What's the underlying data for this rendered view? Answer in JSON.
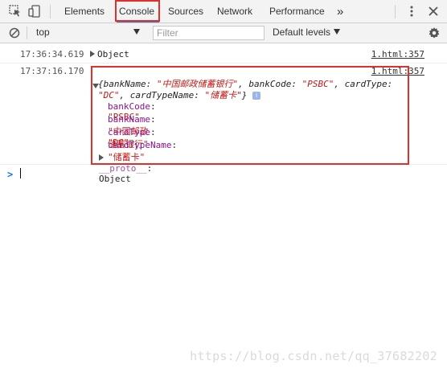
{
  "tabs": [
    "Elements",
    "Console",
    "Sources",
    "Network",
    "Performance"
  ],
  "more_tabs": "»",
  "toolbar": {
    "context": "top",
    "filter_placeholder": "Filter",
    "levels": "Default levels"
  },
  "logs": [
    {
      "timestamp": "17:36:34.619",
      "text": "Object",
      "source": "1.html:357"
    },
    {
      "timestamp": "17:37:16.170",
      "source": "1.html:357",
      "summary_line1_prefix": "{bankName: ",
      "summary_bankName": "\"中国邮政储蓄银行\"",
      "summary_sep1": ", bankCode: ",
      "summary_bankCode": "\"PSBC\"",
      "summary_sep2": ", cardType:",
      "summary_cardType": "\"DC\"",
      "summary_sep3": ", cardTypeName: ",
      "summary_cardTypeName": "\"储蓄卡\"",
      "summary_end": "}",
      "props": [
        {
          "key": "bankCode",
          "value": "\"PSBC\""
        },
        {
          "key": "bankName",
          "value": "\"中国邮政储蓄银行\""
        },
        {
          "key": "cardType",
          "value": "\"DC\""
        },
        {
          "key": "cardTypeName",
          "value": "\"储蓄卡\""
        }
      ],
      "proto_key": "__proto__",
      "proto_value": "Object"
    }
  ],
  "prompt": ">",
  "watermark": "https://blog.csdn.net/qq_37682202",
  "colors": {
    "highlight": "#e0302c",
    "active_tab_underline": "#3879d9"
  }
}
